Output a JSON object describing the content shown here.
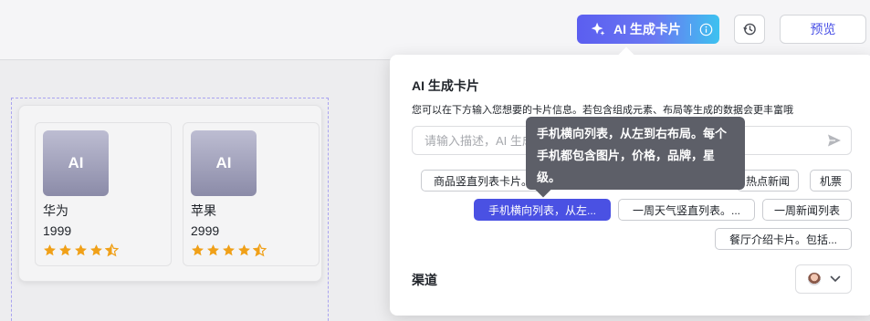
{
  "header": {
    "ai_button_label": "AI 生成卡片",
    "preview_label": "预览"
  },
  "canvas": {
    "products": [
      {
        "thumb_label": "AI",
        "brand": "华为",
        "price": "1999",
        "rating": 4.5
      },
      {
        "thumb_label": "AI",
        "brand": "苹果",
        "price": "2999",
        "rating": 4.5
      }
    ]
  },
  "panel": {
    "title": "AI 生成卡片",
    "description": "您可以在下方输入您想要的卡片信息。若包含组成元素、布局等生成的数据会更丰富哦",
    "input_placeholder": "请输入描述，AI 生成卡片",
    "chips": [
      {
        "label": "商品竖直列表卡片。",
        "active": false
      },
      {
        "label": "热点新闻",
        "active": false
      },
      {
        "label": "机票",
        "active": false
      },
      {
        "label": "手机横向列表，从左...",
        "active": true
      },
      {
        "label": "一周天气竖直列表。...",
        "active": false
      },
      {
        "label": "一周新闻列表",
        "active": false
      },
      {
        "label": "餐厅介绍卡片。包括...",
        "active": false
      }
    ],
    "channel_label": "渠道"
  },
  "tooltip": {
    "text": "手机横向列表，从左到右布局。每个手机都包含图片，价格，品牌，星级。"
  },
  "colors": {
    "accent": "#4a51e3",
    "star": "#f0a018",
    "thumb_gradient_top": "#bdbdd2",
    "thumb_gradient_bottom": "#8b8ba8"
  },
  "icons": {
    "ai_button": "sparkle-icon",
    "ai_info": "info-icon",
    "history": "history-icon",
    "send": "send-icon",
    "channel": "avatar-icon",
    "dropdown": "chevron-down-icon",
    "rating": "star-icon"
  }
}
